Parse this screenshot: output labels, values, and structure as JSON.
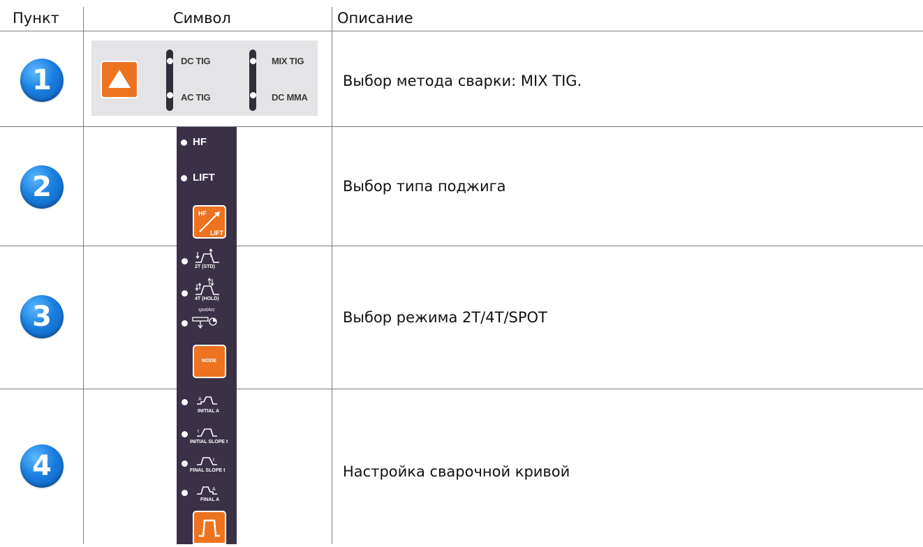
{
  "headers": {
    "item": "Пункт",
    "symbol": "Символ",
    "description": "Описание"
  },
  "rows": [
    {
      "number": "1",
      "description": "Выбор метода сварки: MIX TIG."
    },
    {
      "number": "2",
      "description": "Выбор типа поджига"
    },
    {
      "number": "3",
      "description": "Выбор режима 2T/4T/SPOT"
    },
    {
      "number": "4",
      "description": "Настройка сварочной кривой"
    }
  ],
  "row1_panel": {
    "dc_tig": "DC TIG",
    "ac_tig": "AC TIG",
    "mix_tig": "MIX TIG",
    "dc_mma": "DC MMA"
  },
  "row2_panel": {
    "hf": "HF",
    "lift": "LIFT",
    "btn_hf": "HF",
    "btn_lift": "LIFT"
  },
  "row3_panel": {
    "mode_2t": "2T (STD)",
    "mode_4t": "4T (HOLD)",
    "spot": "spotArc",
    "mode_btn": "MODE"
  },
  "row4_panel": {
    "initial_a": "INITIAL A",
    "initial_slope": "INITIAL SLOPE t",
    "final_slope": "FINAL SLOPE t",
    "final_a": "FINAL A"
  },
  "colors": {
    "orange": "#ed7320",
    "dark_panel": "#3a3146",
    "badge_blue": "#1a7fe0",
    "light_panel": "#e4e4e6"
  }
}
